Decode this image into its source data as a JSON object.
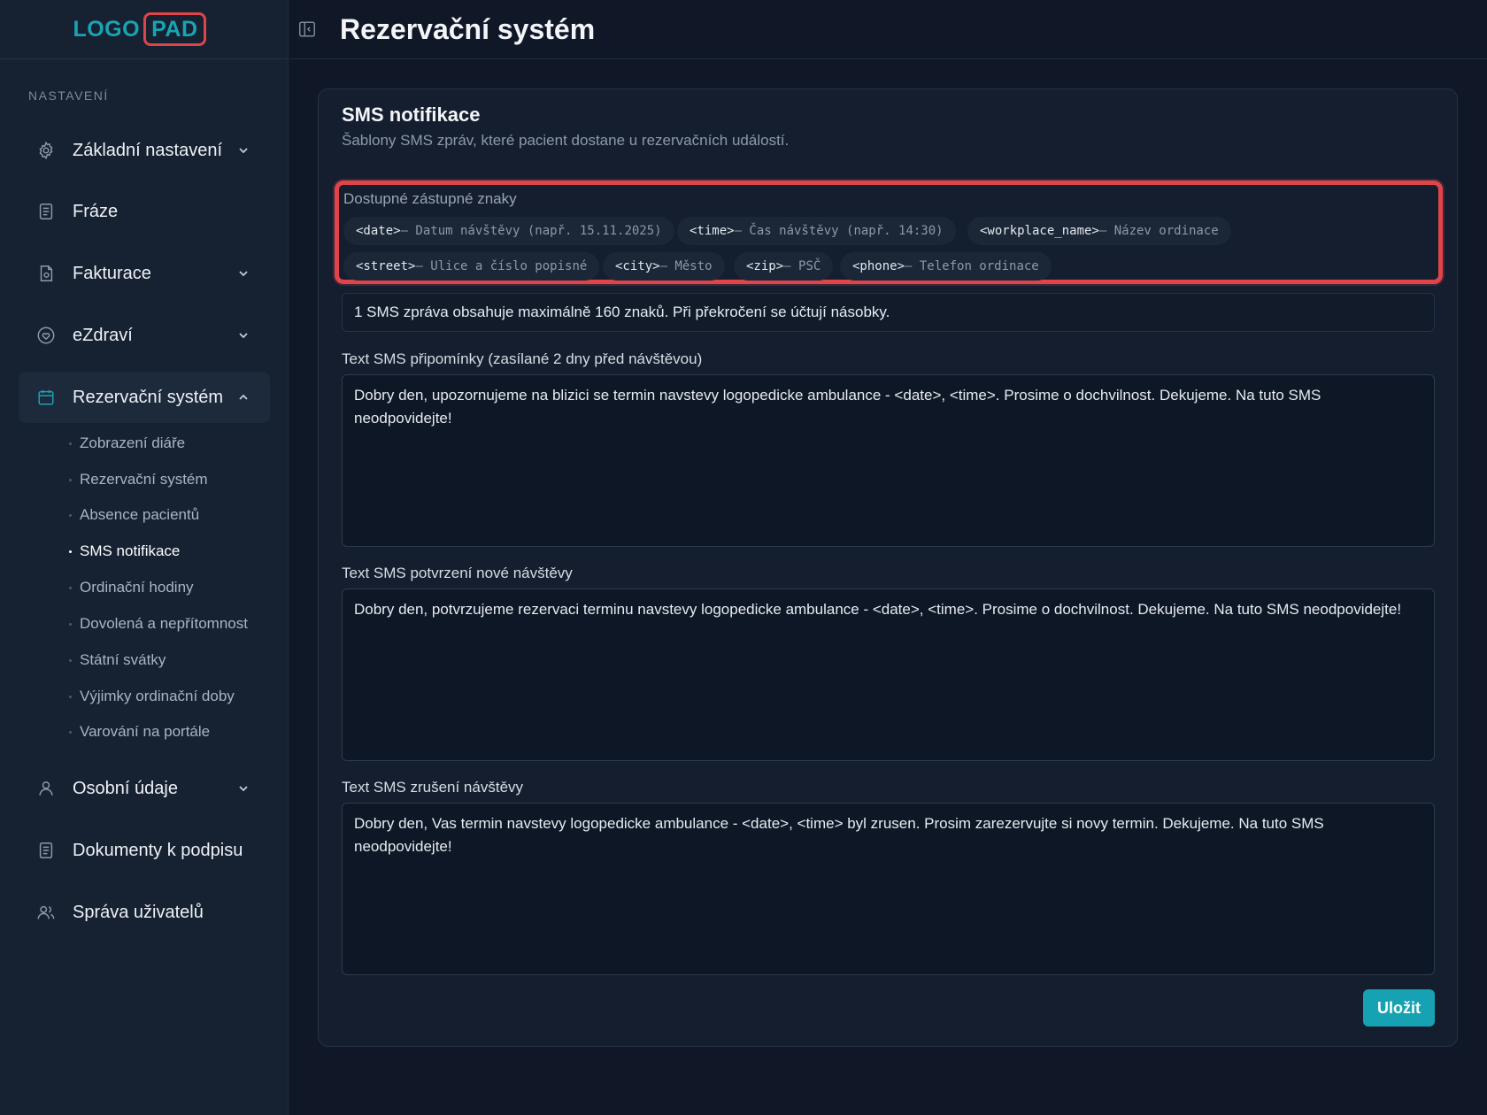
{
  "logo": {
    "part1": "LOGO",
    "part2": "PAD"
  },
  "sidebar": {
    "section_label": "NASTAVENÍ",
    "items": [
      {
        "label": "Základní nastavení",
        "icon": "gear-icon"
      },
      {
        "label": "Fráze",
        "icon": "document-icon"
      },
      {
        "label": "Fakturace",
        "icon": "invoice-icon"
      },
      {
        "label": "eZdraví",
        "icon": "heart-icon"
      },
      {
        "label": "Rezervační systém",
        "icon": "calendar-icon"
      },
      {
        "label": "Osobní údaje",
        "icon": "user-icon"
      },
      {
        "label": "Dokumenty k podpisu",
        "icon": "document-icon"
      },
      {
        "label": "Správa uživatelů",
        "icon": "users-icon"
      }
    ],
    "subitems": [
      "Zobrazení diáře",
      "Rezervační systém",
      "Absence pacientů",
      "SMS notifikace",
      "Ordinační hodiny",
      "Dovolená a nepřítomnost",
      "Státní svátky",
      "Výjimky ordinační doby",
      "Varování na portále"
    ]
  },
  "header": {
    "title": "Rezervační systém"
  },
  "card": {
    "title": "SMS notifikace",
    "subtitle": "Šablony SMS zpráv, které pacient dostane u rezervačních událostí.",
    "placeholders_title": "Dostupné zástupné znaky",
    "placeholders": [
      {
        "code": "<date>",
        "desc": " – Datum návštěvy (např. 15.11.2025)"
      },
      {
        "code": "<time>",
        "desc": " – Čas návštěvy (např. 14:30)"
      },
      {
        "code": "<workplace_name>",
        "desc": " – Název ordinace"
      },
      {
        "code": "<street>",
        "desc": " – Ulice a číslo popisné"
      },
      {
        "code": "<city>",
        "desc": " – Město"
      },
      {
        "code": "<zip>",
        "desc": " – PSČ"
      },
      {
        "code": "<phone>",
        "desc": " – Telefon ordinace"
      }
    ],
    "info": "1 SMS zpráva obsahuje maximálně 160 znaků. Při překročení se účtují násobky.",
    "fields": [
      {
        "label": "Text SMS připomínky (zasílané 2 dny před návštěvou)",
        "value": "Dobry den, upozornujeme na blizici se termin navstevy logopedicke ambulance - <date>, <time>. Prosime o dochvilnost. Dekujeme. Na tuto SMS neodpovidejte!"
      },
      {
        "label": "Text SMS potvrzení nové návštěvy",
        "value": "Dobry den, potvrzujeme rezervaci terminu navstevy logopedicke ambulance - <date>, <time>. Prosime o dochvilnost. Dekujeme. Na tuto SMS neodpovidejte!"
      },
      {
        "label": "Text SMS zrušení návštěvy",
        "value": "Dobry den, Vas termin navstevy logopedicke ambulance - <date>, <time> byl zrusen. Prosim zarezervujte si novy termin. Dekujeme. Na tuto SMS neodpovidejte!"
      }
    ],
    "save_label": "Uložit"
  },
  "colors": {
    "accent": "#17a2b4",
    "highlight": "#e0444b",
    "background": "#101828",
    "sidebar": "#162131"
  }
}
